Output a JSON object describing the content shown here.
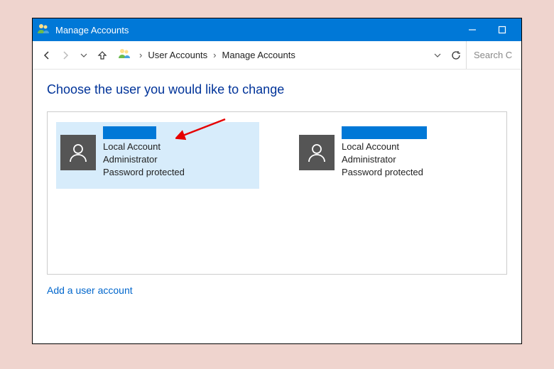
{
  "titlebar": {
    "title": "Manage Accounts"
  },
  "nav": {
    "loc_brand": "",
    "crumb1": "User Accounts",
    "crumb2": "Manage Accounts",
    "search_placeholder": "Search C"
  },
  "main": {
    "heading": "Choose the user you would like to change"
  },
  "users": [
    {
      "name_redacted": "hidden",
      "line1": "Local Account",
      "line2": "Administrator",
      "line3": "Password protected",
      "selected": true
    },
    {
      "name_redacted": "hidden",
      "line1": "Local Account",
      "line2": "Administrator",
      "line3": "Password protected",
      "selected": false
    }
  ],
  "footer": {
    "add_user": "Add a user account"
  }
}
